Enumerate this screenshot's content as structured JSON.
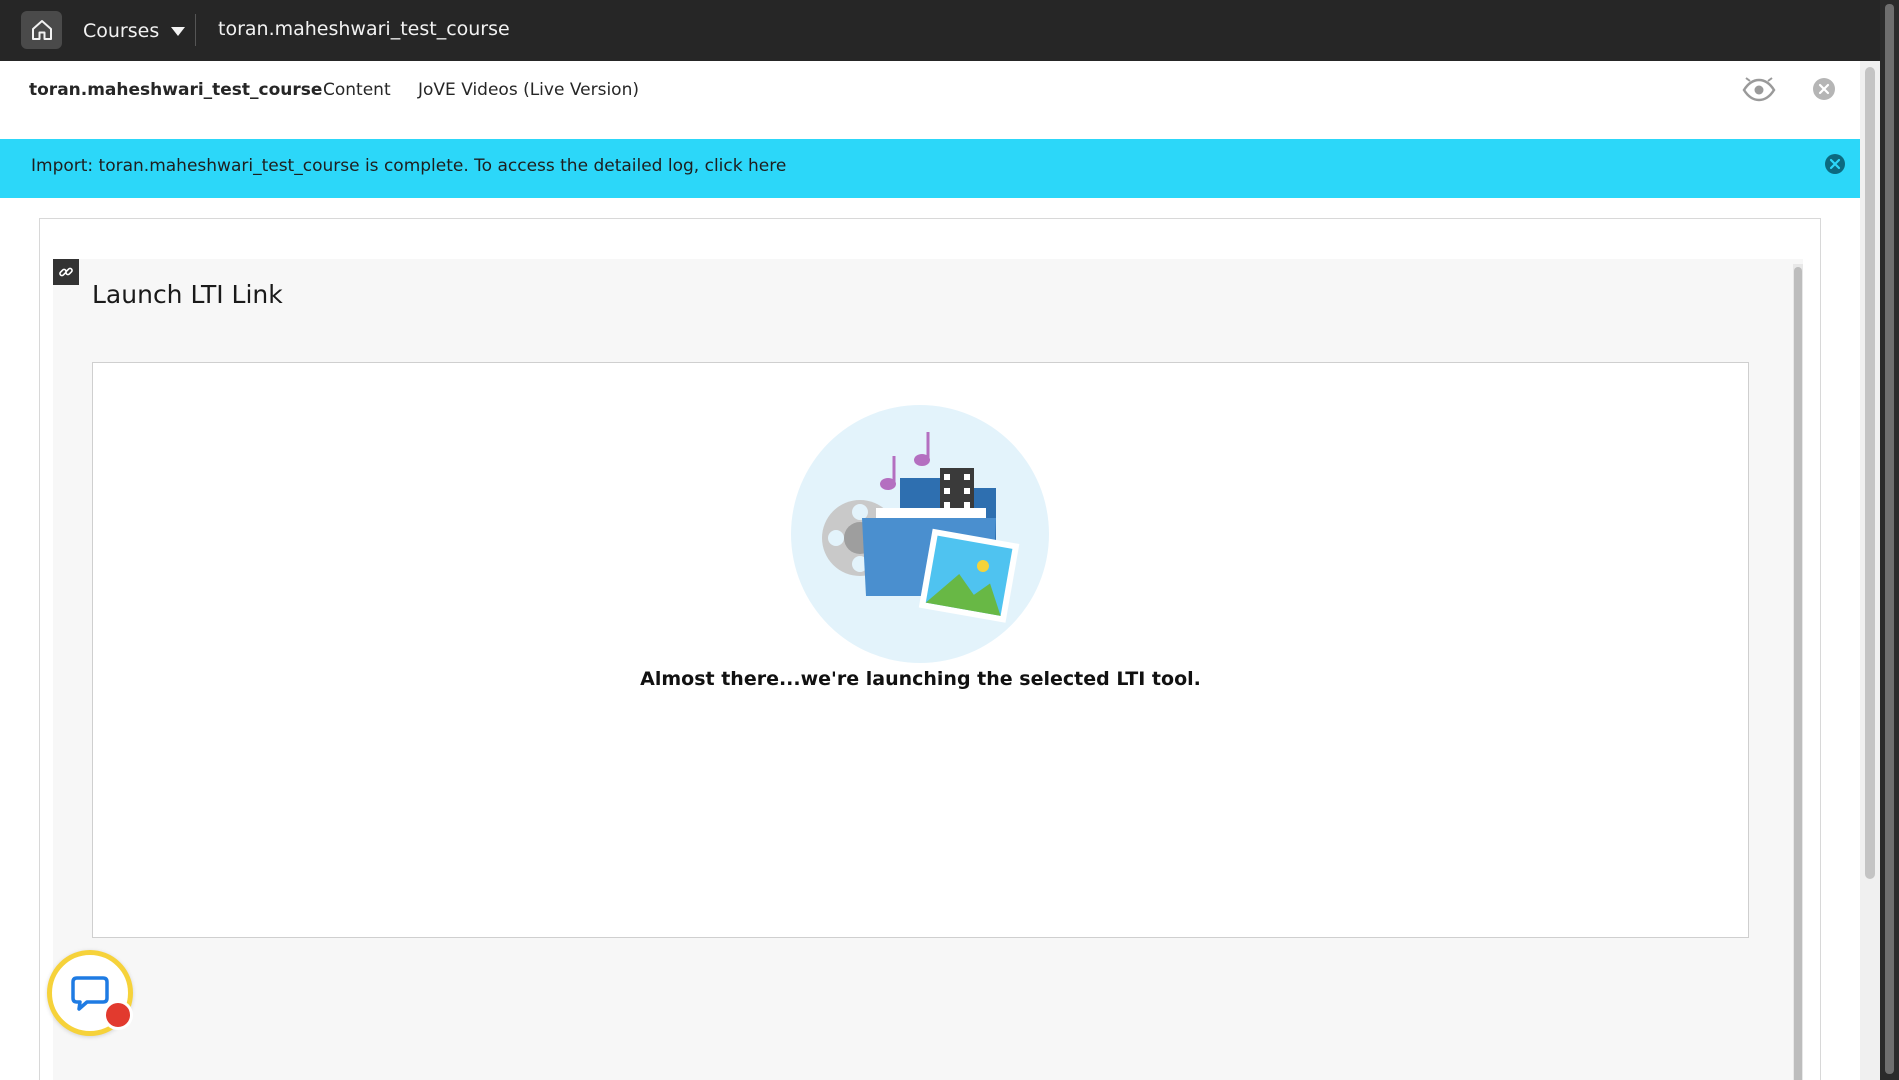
{
  "topbar": {
    "home_icon": "home-icon",
    "courses_label": "Courses",
    "breadcrumb": "toran.maheshwari_test_course"
  },
  "course_nav": {
    "course_title": "toran.maheshwari_test_course",
    "links": [
      "Content",
      "JoVE Videos (Live Version)"
    ],
    "icons": [
      "eye-icon",
      "close-icon"
    ]
  },
  "banner": {
    "message": "Import: toran.maheshwari_test_course is complete. To access the detailed log, click here",
    "color": "#2cd7f9"
  },
  "content_item": {
    "icon": "link-icon",
    "title": "Launch LTI Link",
    "status": "Almost there...we're launching the selected LTI tool."
  },
  "chat": {
    "icon": "chat-bubble-icon",
    "ring_color": "#f6d23a",
    "badge_color": "#e23a2e"
  }
}
